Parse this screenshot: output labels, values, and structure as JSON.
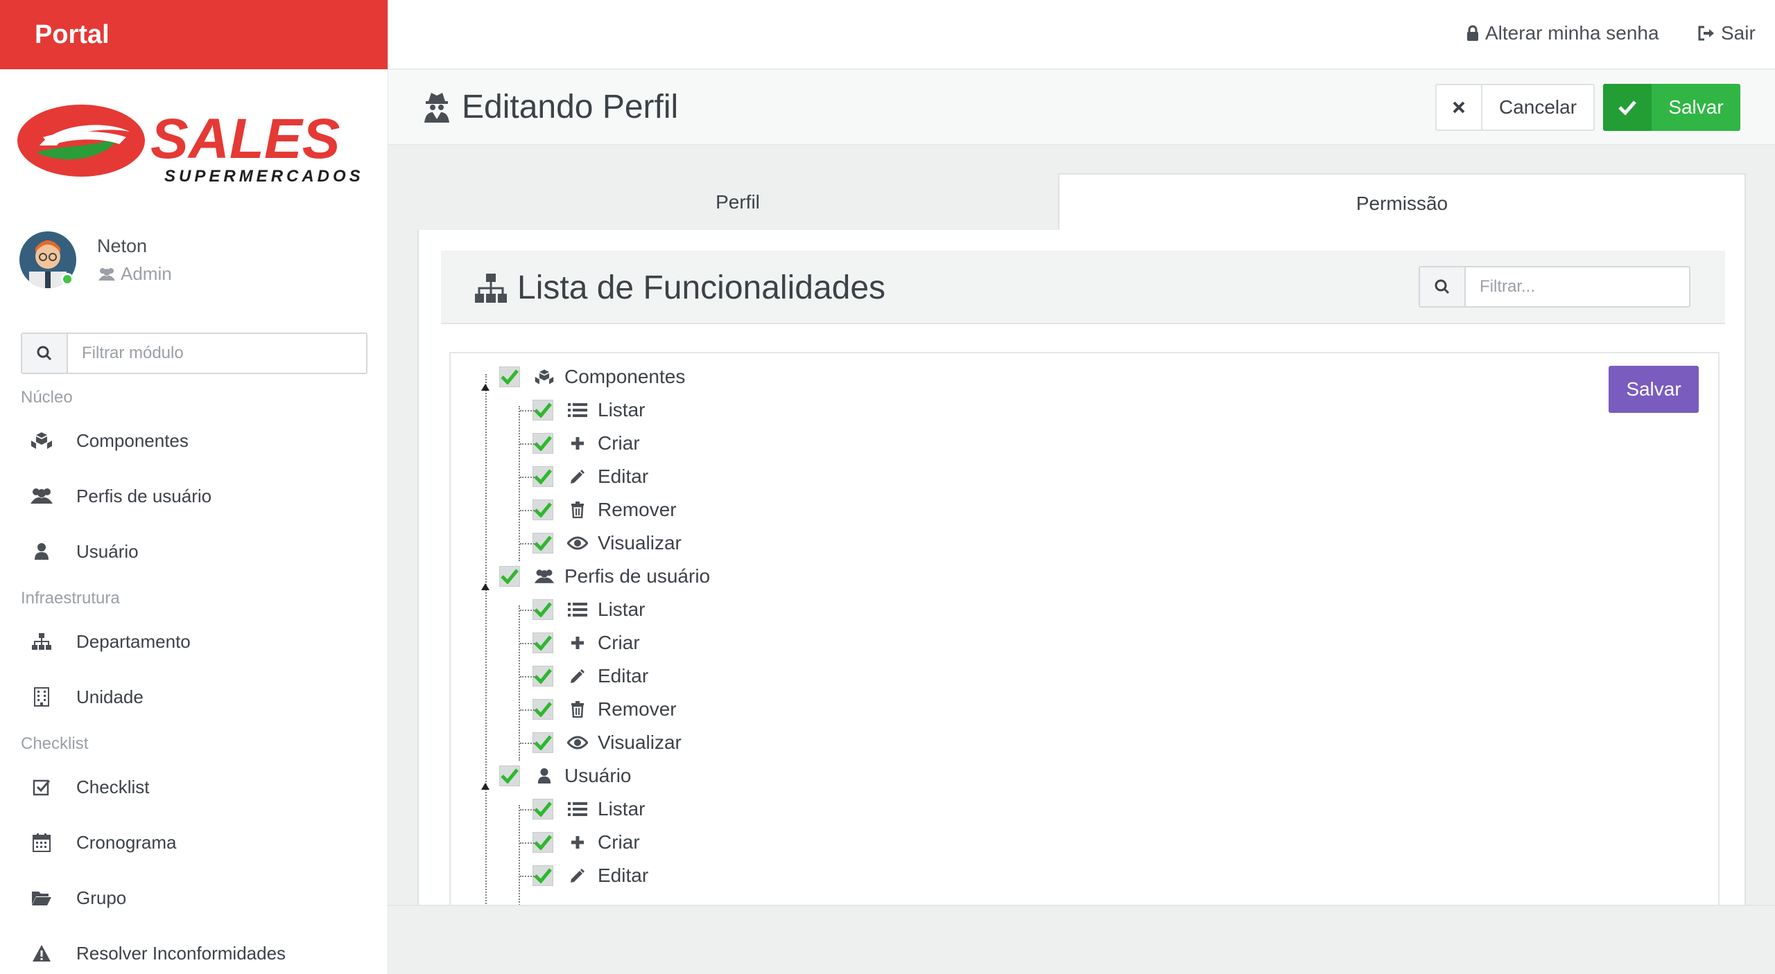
{
  "brand": {
    "title": "Portal",
    "logo_main": "SALES",
    "logo_sub": "SUPERMERCADOS",
    "accent": "#e53935"
  },
  "user": {
    "name": "Neton",
    "role": "Admin",
    "role_icon": "users-icon"
  },
  "sidebar": {
    "search_placeholder": "Filtrar módulo",
    "sections": [
      {
        "label": "Núcleo"
      },
      {
        "label": "Infraestrutura"
      },
      {
        "label": "Checklist"
      }
    ],
    "items": [
      {
        "label": "Componentes",
        "icon": "cubes-icon"
      },
      {
        "label": "Perfis de usuário",
        "icon": "users-icon"
      },
      {
        "label": "Usuário",
        "icon": "user-icon"
      },
      {
        "label": "Departamento",
        "icon": "sitemap-icon"
      },
      {
        "label": "Unidade",
        "icon": "building-icon"
      },
      {
        "label": "Checklist",
        "icon": "check-square-icon"
      },
      {
        "label": "Cronograma",
        "icon": "calendar-icon"
      },
      {
        "label": "Grupo",
        "icon": "folder-open-icon"
      },
      {
        "label": "Resolver Inconformidades",
        "icon": "warning-icon"
      }
    ]
  },
  "topbar": {
    "change_password": "Alterar minha senha",
    "logout": "Sair"
  },
  "header": {
    "title": "Editando Perfil",
    "cancel": "Cancelar",
    "save": "Salvar"
  },
  "tabs": [
    {
      "label": "Perfil",
      "active": false
    },
    {
      "label": "Permissão",
      "active": true
    }
  ],
  "panel": {
    "title": "Lista de Funcionalidades",
    "filter_placeholder": "Filtrar...",
    "save": "Salvar"
  },
  "tree": [
    {
      "label": "Componentes",
      "icon": "cubes-icon",
      "checked": true,
      "level": 0
    },
    {
      "label": "Listar",
      "icon": "list-icon",
      "checked": true,
      "level": 1
    },
    {
      "label": "Criar",
      "icon": "plus-icon",
      "checked": true,
      "level": 1
    },
    {
      "label": "Editar",
      "icon": "pencil-icon",
      "checked": true,
      "level": 1
    },
    {
      "label": "Remover",
      "icon": "trash-icon",
      "checked": true,
      "level": 1
    },
    {
      "label": "Visualizar",
      "icon": "eye-icon",
      "checked": true,
      "level": 1
    },
    {
      "label": "Perfis de usuário",
      "icon": "users-icon",
      "checked": true,
      "level": 0
    },
    {
      "label": "Listar",
      "icon": "list-icon",
      "checked": true,
      "level": 1
    },
    {
      "label": "Criar",
      "icon": "plus-icon",
      "checked": true,
      "level": 1
    },
    {
      "label": "Editar",
      "icon": "pencil-icon",
      "checked": true,
      "level": 1
    },
    {
      "label": "Remover",
      "icon": "trash-icon",
      "checked": true,
      "level": 1
    },
    {
      "label": "Visualizar",
      "icon": "eye-icon",
      "checked": true,
      "level": 1
    },
    {
      "label": "Usuário",
      "icon": "user-icon",
      "checked": true,
      "level": 0
    },
    {
      "label": "Listar",
      "icon": "list-icon",
      "checked": true,
      "level": 1
    },
    {
      "label": "Criar",
      "icon": "plus-icon",
      "checked": true,
      "level": 1
    },
    {
      "label": "Editar",
      "icon": "pencil-icon",
      "checked": true,
      "level": 1
    }
  ],
  "colors": {
    "save_green": "#31b544",
    "save_purple": "#7a5cbf",
    "check_green": "#2eb82e"
  }
}
